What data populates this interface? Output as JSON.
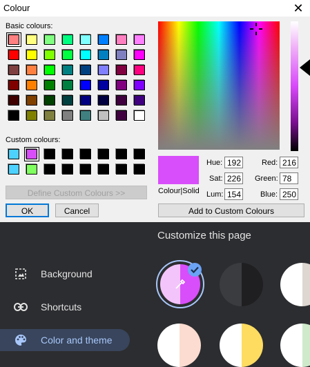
{
  "dialog": {
    "title": "Colour",
    "basic_label": "Basic colours:",
    "custom_label": "Custom colours:",
    "define_button": "Define Custom Colours >>",
    "ok_button": "OK",
    "cancel_button": "Cancel",
    "add_button": "Add to Custom Colours",
    "colour_solid_label": "Colour|Solid",
    "hue_label": "Hue:",
    "sat_label": "Sat:",
    "lum_label": "Lum:",
    "red_label": "Red:",
    "green_label": "Green:",
    "blue_label": "Blue:",
    "hue": "192",
    "sat": "226",
    "lum": "154",
    "red": "216",
    "green": "78",
    "blue": "250",
    "selected_colour": "#d84efa",
    "basic_colours": [
      [
        "#ff8080",
        "#ffff80",
        "#80ff80",
        "#00ff80",
        "#80ffff",
        "#0080ff",
        "#ff80c0",
        "#ff80ff"
      ],
      [
        "#ff0000",
        "#ffff00",
        "#80ff00",
        "#00ff40",
        "#00ffff",
        "#0080c0",
        "#8080c0",
        "#ff00ff"
      ],
      [
        "#804040",
        "#ff8040",
        "#00ff00",
        "#008080",
        "#004080",
        "#8080ff",
        "#800040",
        "#ff0080"
      ],
      [
        "#800000",
        "#ff8000",
        "#008000",
        "#008040",
        "#0000ff",
        "#0000a0",
        "#800080",
        "#8000ff"
      ],
      [
        "#400000",
        "#804000",
        "#004000",
        "#004040",
        "#000080",
        "#000040",
        "#400040",
        "#400080"
      ],
      [
        "#000000",
        "#808000",
        "#808040",
        "#808080",
        "#408080",
        "#c0c0c0",
        "#400040",
        "#ffffff"
      ]
    ],
    "custom_colours": [
      [
        "#4dd2ff",
        "#d84efa",
        "#000000",
        "#000000",
        "#000000",
        "#000000",
        "#000000",
        "#000000"
      ],
      [
        "#4dd2ff",
        "#80ff60",
        "#000000",
        "#000000",
        "#000000",
        "#000000",
        "#000000",
        "#000000"
      ]
    ]
  },
  "panel": {
    "title": "Customize this page",
    "items": [
      {
        "label": "Background",
        "icon": "image-icon"
      },
      {
        "label": "Shortcuts",
        "icon": "link-icon"
      },
      {
        "label": "Color and theme",
        "icon": "palette-icon"
      }
    ]
  }
}
